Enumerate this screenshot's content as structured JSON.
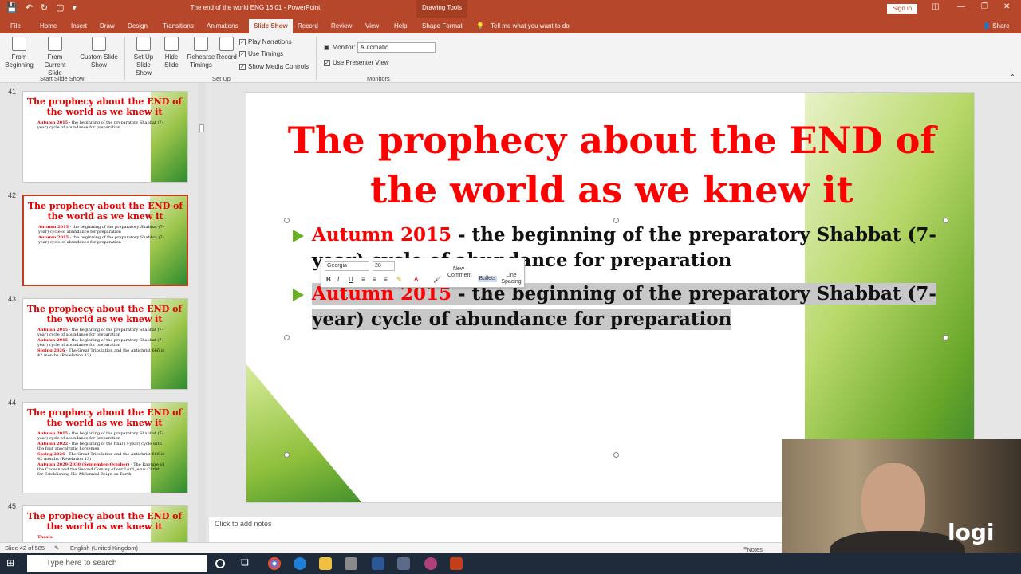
{
  "titlebar": {
    "title": "The end of the world ENG 16 01  -  PowerPoint",
    "context_tab": "Drawing Tools",
    "signin": "Sign in"
  },
  "tabs": [
    "File",
    "Home",
    "Insert",
    "Draw",
    "Design",
    "Transitions",
    "Animations",
    "Slide Show",
    "Record",
    "Review",
    "View",
    "Help",
    "Shape Format"
  ],
  "tell_me": "Tell me what you want to do",
  "share": "Share",
  "ribbon": {
    "from_beginning": "From Beginning",
    "from_current": "From Current Slide",
    "custom_show": "Custom Slide Show",
    "group_start": "Start Slide Show",
    "setup_show": "Set Up Slide Show",
    "hide_slide": "Hide Slide",
    "rehearse": "Rehearse Timings",
    "record": "Record",
    "play_narrations": "Play Narrations",
    "use_timings": "Use Timings",
    "show_media": "Show Media Controls",
    "group_setup": "Set Up",
    "monitor_label": "Monitor:",
    "monitor_value": "Automatic",
    "presenter_view": "Use Presenter View",
    "group_monitors": "Monitors"
  },
  "thumbnails": [
    {
      "num": "41",
      "title": "The prophecy about the END of the world as we knew it",
      "bullets": [
        {
          "red": "Autumn 2015",
          "rest": " - the beginning of the preparatory Shabbat (7-year) cycle of abundance for preparation"
        }
      ]
    },
    {
      "num": "42",
      "title": "The prophecy about the END of the world as we knew it",
      "bullets": [
        {
          "red": "Autumn 2015",
          "rest": " - the beginning of the preparatory Shabbat (7-year) cycle of abundance for preparation"
        },
        {
          "red": "Autumn 2015",
          "rest": " - the beginning of the preparatory Shabbat (7-year) cycle of abundance for preparation"
        }
      ]
    },
    {
      "num": "43",
      "title": "The prophecy about the END of the world as we knew it",
      "bullets": [
        {
          "red": "Autumn 2015",
          "rest": " - the beginning of the preparatory Shabbat (7-year) cycle of abundance for preparation"
        },
        {
          "red": "Autumn 2015",
          "rest": " - the beginning of the preparatory Shabbat (7-year) cycle of abundance for preparation"
        },
        {
          "red": "Spring 2026",
          "rest": " - The Great Tribulation and the Antichrist 666 in 42 months (Revelation 13)"
        }
      ]
    },
    {
      "num": "44",
      "title": "The prophecy about the END of the world as we knew it",
      "bullets": [
        {
          "red": "Autumn 2015",
          "rest": " - the beginning of the preparatory Shabbat (7-year) cycle of abundance for preparation"
        },
        {
          "red": "Autumn 2022",
          "rest": " - the beginning of the final (7-year) cycle with the four apocalyptic horsemen"
        },
        {
          "red": "Spring 2026",
          "rest": " - The Great Tribulation and the Antichrist 666 in 42 months (Revelation 13)"
        },
        {
          "red": "Autumn 2029-2030 (September-October)",
          "rest": " - The Rapture of the Chosen and the Second Coming of our Lord Jesus Christ for Establishing His Millennial Reign on Earth"
        }
      ]
    },
    {
      "num": "45",
      "title": "The prophecy about the END of the world as we knew it",
      "bullets": [
        {
          "red": "Thesis:",
          "rest": ""
        }
      ]
    }
  ],
  "slide": {
    "title": "The prophecy about the END of the world as we knew it",
    "bullet1_red": "Autumn 2015",
    "bullet1_rest": " - the beginning of the preparatory Shabbat (7-year) cycle of abundance for preparation",
    "bullet2_red": "Autumn 2015",
    "bullet2_rest": " - the beginning of the preparatory Shabbat (7-year) cycle of abundance for preparation"
  },
  "minitoolbar": {
    "font": "Georgia",
    "size": "28",
    "new_comment": "New Comment",
    "bullets": "Bullets",
    "line_spacing": "Line Spacing",
    "numbering": "Numbering"
  },
  "notes_placeholder": "Click to add notes",
  "status": {
    "slide": "Slide 42 of 585",
    "language": "English (United Kingdom)",
    "notes": "Notes"
  },
  "webcam": {
    "logo": "logi"
  },
  "taskbar": {
    "search": "Type here to search"
  },
  "colors": {
    "accent": "#b7472a",
    "title_red": "#ff0000",
    "bullet_green": "#6ab023"
  }
}
